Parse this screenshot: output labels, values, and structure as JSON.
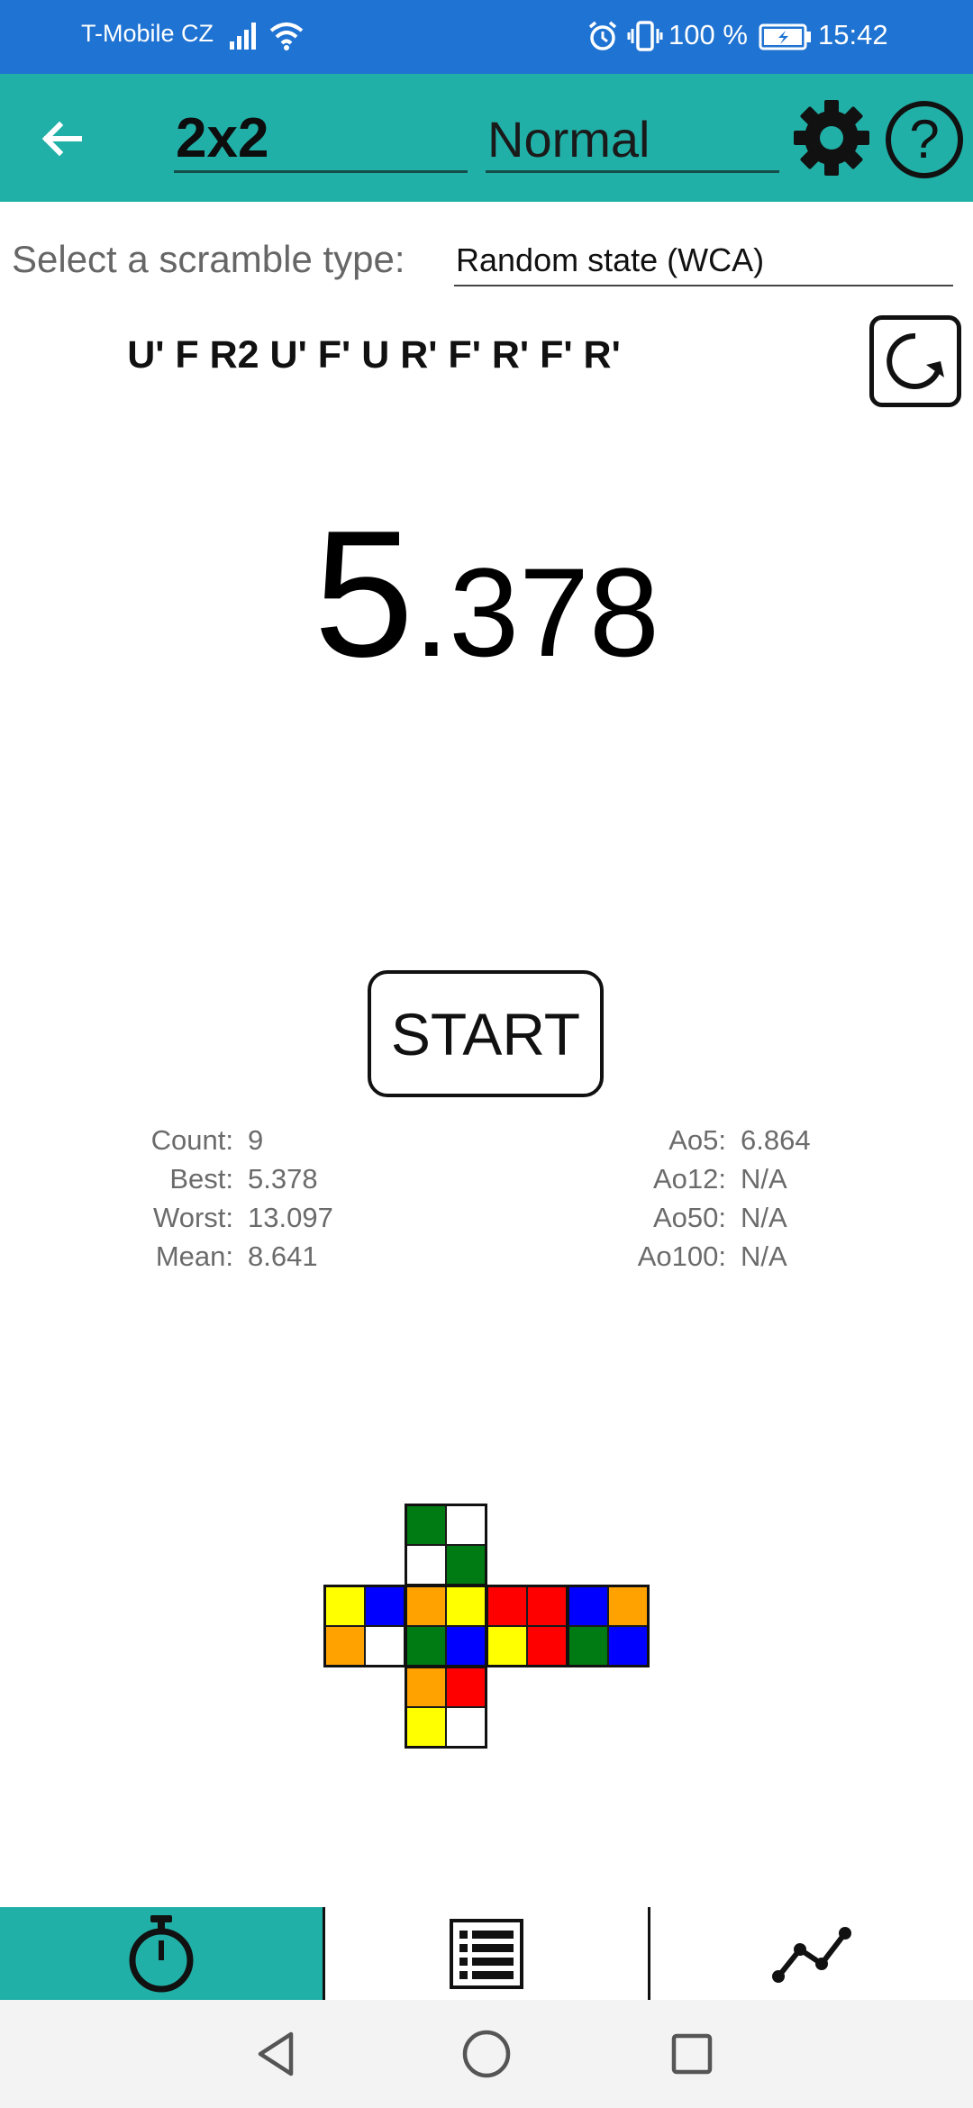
{
  "status_bar": {
    "carrier": "T-Mobile CZ",
    "battery_text": "100 %",
    "time": "15:42"
  },
  "toolbar": {
    "puzzle": "2x2",
    "mode": "Normal"
  },
  "scramble": {
    "type_label": "Select a scramble type:",
    "type_value": "Random state (WCA)",
    "moves": "U' F R2 U' F' U R' F' R' F' R'"
  },
  "timer": {
    "seconds": "5",
    "fraction": ".378"
  },
  "start_label": "START",
  "stats": {
    "left": [
      {
        "label": "Count:",
        "value": "9"
      },
      {
        "label": "Best:",
        "value": "5.378"
      },
      {
        "label": "Worst:",
        "value": "13.097"
      },
      {
        "label": "Mean:",
        "value": "8.641"
      }
    ],
    "right": [
      {
        "label": "Ao5:",
        "value": "6.864"
      },
      {
        "label": "Ao12:",
        "value": "N/A"
      },
      {
        "label": "Ao50:",
        "value": "N/A"
      },
      {
        "label": "Ao100:",
        "value": "N/A"
      }
    ]
  },
  "cube_colors": {
    "G": "#007a12",
    "W": "#ffffff",
    "Y": "#ffff00",
    "B": "#0000ff",
    "O": "#ffa200",
    "R": "#ff0000"
  },
  "cube_net": {
    "U": [
      [
        "G",
        "W"
      ],
      [
        "W",
        "G"
      ]
    ],
    "L": [
      [
        "Y",
        "B"
      ],
      [
        "O",
        "W"
      ]
    ],
    "F": [
      [
        "O",
        "Y"
      ],
      [
        "G",
        "B"
      ]
    ],
    "R": [
      [
        "R",
        "R"
      ],
      [
        "Y",
        "R"
      ]
    ],
    "B": [
      [
        "B",
        "O"
      ],
      [
        "G",
        "B"
      ]
    ],
    "D": [
      [
        "O",
        "R"
      ],
      [
        "Y",
        "W"
      ]
    ]
  },
  "colors": {
    "status_bar": "#1f73d2",
    "toolbar": "#21b0a7",
    "active_tab": "#21b0a7"
  },
  "icons": {
    "back": "arrow-left-icon",
    "settings": "gear-icon",
    "help": "question-icon",
    "refresh": "refresh-icon",
    "timer_tab": "stopwatch-icon",
    "list_tab": "list-icon",
    "graph_tab": "graph-icon"
  }
}
